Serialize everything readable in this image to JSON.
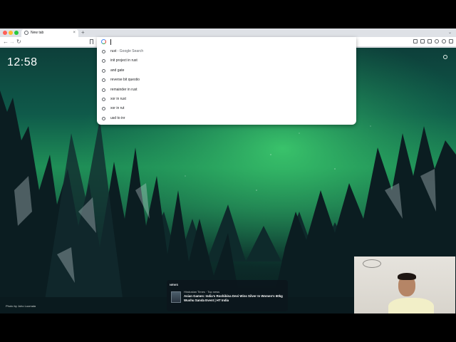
{
  "browser": {
    "tab": {
      "title": "New tab",
      "close": "×"
    },
    "new_tab": "+",
    "tabstrip_menu": "⌄",
    "nav": {
      "back": "←",
      "forward": "→",
      "reload": "↻"
    }
  },
  "newtab_page": {
    "clock": "12:58",
    "photo_credit": "Photo by Juho Luomala"
  },
  "omnibox": {
    "suggestions": [
      {
        "text": "rust",
        "suffix": " - Google Search"
      },
      {
        "text": "init project in rust",
        "suffix": ""
      },
      {
        "text": "and gate",
        "suffix": ""
      },
      {
        "text": "reverse bit questio",
        "suffix": ""
      },
      {
        "text": "remainder in rust",
        "suffix": ""
      },
      {
        "text": "xor in rust",
        "suffix": ""
      },
      {
        "text": "xor in rut",
        "suffix": ""
      },
      {
        "text": "usd to inr",
        "suffix": ""
      }
    ]
  },
  "news": {
    "heading": "NEWS",
    "source": "Hindustan Times",
    "separator": " · ",
    "tag": "Top news",
    "title": "Asian Games: India's Roshibina Devi Wins Silver In Women's 60kg Wushu Sanda Event | HT India"
  },
  "colors": {
    "aurora": "#1f8f57",
    "sky_dark": "#0d3f3a",
    "tree_dark": "#0a1a1e",
    "snow": "#c9d6da"
  },
  "icons": [
    "history-icon",
    "google-icon",
    "bookmark-icon",
    "customize-icon",
    "extension-icon"
  ]
}
